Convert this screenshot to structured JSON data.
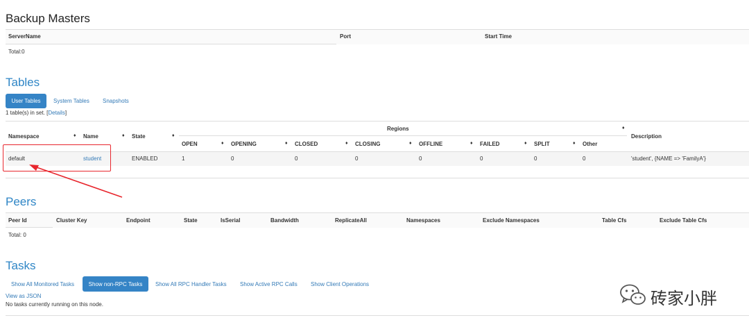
{
  "backup_masters": {
    "title": "Backup Masters",
    "columns": [
      "ServerName",
      "Port",
      "Start Time"
    ],
    "total": "Total:0"
  },
  "tables": {
    "title": "Tables",
    "tabs": [
      "User Tables",
      "System Tables",
      "Snapshots"
    ],
    "count_prefix": "1 table(s) in set. [",
    "details_link": "Details",
    "count_suffix": "]",
    "headers": {
      "namespace": "Namespace",
      "name": "Name",
      "state": "State",
      "regions": "Regions",
      "description": "Description",
      "region_cols": [
        "OPEN",
        "OPENING",
        "CLOSED",
        "CLOSING",
        "OFFLINE",
        "FAILED",
        "SPLIT",
        "Other"
      ]
    },
    "sort_glyph": "♦",
    "rows": [
      {
        "namespace": "default",
        "name": "student",
        "state": "ENABLED",
        "regions": [
          "1",
          "0",
          "0",
          "0",
          "0",
          "0",
          "0",
          "0"
        ],
        "description": "'student', {NAME => 'FamilyA'}"
      }
    ]
  },
  "peers": {
    "title": "Peers",
    "columns": [
      "Peer Id",
      "Cluster Key",
      "Endpoint",
      "State",
      "IsSerial",
      "Bandwidth",
      "ReplicateAll",
      "Namespaces",
      "Exclude Namespaces",
      "Table Cfs",
      "Exclude Table Cfs"
    ],
    "total": "Total: 0"
  },
  "tasks": {
    "title": "Tasks",
    "tabs": [
      "Show All Monitored Tasks",
      "Show non-RPC Tasks",
      "Show All RPC Handler Tasks",
      "Show Active RPC Calls",
      "Show Client Operations"
    ],
    "view_json": "View as JSON",
    "empty": "No tasks currently running on this node."
  },
  "watermark": {
    "text": "砖家小胖",
    "icon": "wechat-icon"
  },
  "colors": {
    "accent": "#3584c6",
    "link": "#337ab7",
    "highlight": "#e8262d"
  }
}
